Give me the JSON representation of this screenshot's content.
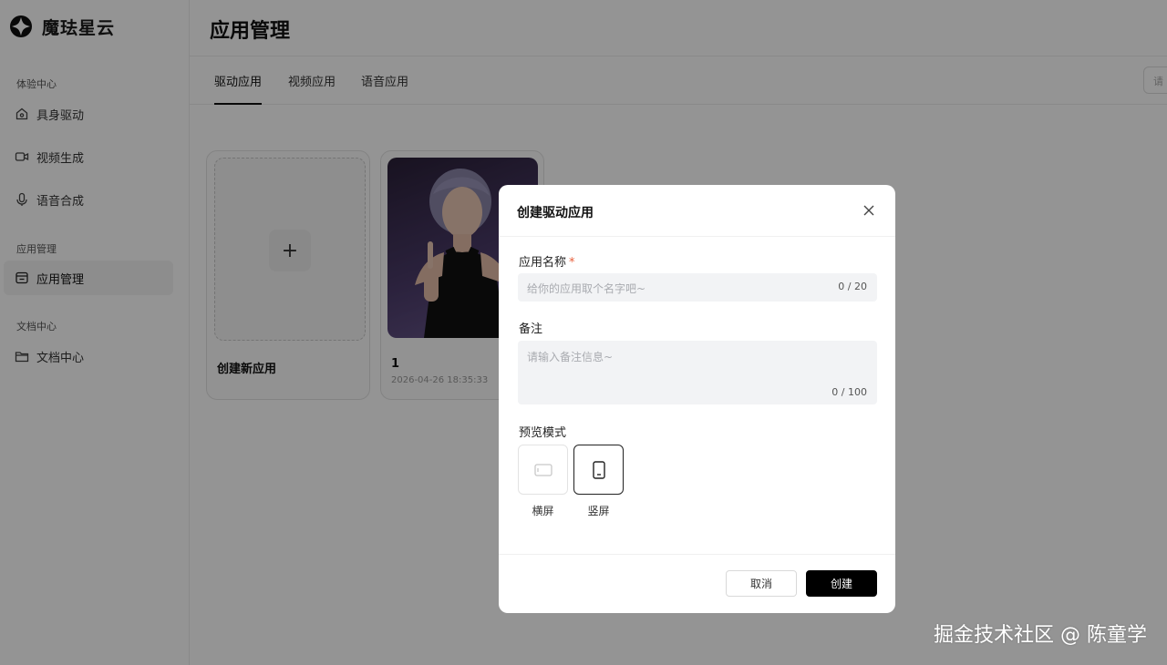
{
  "app": {
    "brand_name": "魔珐星云"
  },
  "sidebar": {
    "groups": [
      {
        "title": "体验中心",
        "items": [
          {
            "label": "具身驱动",
            "icon": "home-icon"
          },
          {
            "label": "视频生成",
            "icon": "video-icon"
          },
          {
            "label": "语音合成",
            "icon": "mic-icon"
          }
        ]
      },
      {
        "title": "应用管理",
        "items": [
          {
            "label": "应用管理",
            "icon": "app-manage-icon",
            "active": true
          }
        ]
      },
      {
        "title": "文档中心",
        "items": [
          {
            "label": "文档中心",
            "icon": "folder-icon"
          }
        ]
      }
    ]
  },
  "header": {
    "title": "应用管理",
    "search_placeholder": "请"
  },
  "tabs": [
    {
      "label": "驱动应用",
      "active": true
    },
    {
      "label": "视频应用"
    },
    {
      "label": "语音应用"
    }
  ],
  "cards": {
    "create_label": "创建新应用",
    "apps": [
      {
        "name": "1",
        "created_at": "2026-04-26 18:35:33"
      }
    ]
  },
  "modal": {
    "title": "创建驱动应用",
    "name_label": "应用名称",
    "name_required_mark": "*",
    "name_placeholder": "给你的应用取个名字吧~",
    "name_count": "0 / 20",
    "note_label": "备注",
    "note_placeholder": "请输入备注信息~",
    "note_count": "0 / 100",
    "preview_label": "预览模式",
    "modes": [
      {
        "label": "横屏",
        "icon": "landscape-icon",
        "selected": false
      },
      {
        "label": "竖屏",
        "icon": "portrait-icon",
        "selected": true
      }
    ],
    "cancel_label": "取消",
    "create_label": "创建"
  },
  "watermark": "掘金技术社区 @ 陈童学",
  "colors": {
    "primary_button": "#000000",
    "required": "#e8603c",
    "overlay": "rgba(0,0,0,0.42)"
  }
}
